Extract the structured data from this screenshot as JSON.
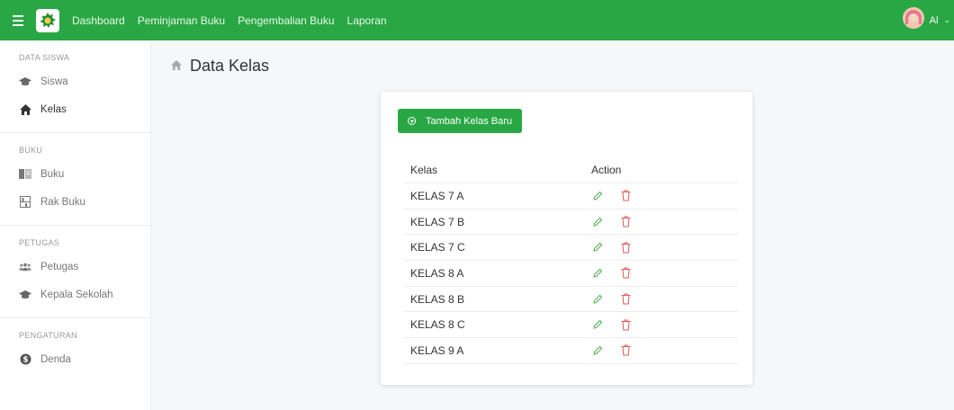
{
  "topbar": {
    "nav": [
      "Dashboard",
      "Peminjaman Buku",
      "Pengembalian Buku",
      "Laporan"
    ],
    "user_name": "Al"
  },
  "sidebar": {
    "sections": [
      {
        "title": "DATA SISWA",
        "items": [
          {
            "label": "Siswa",
            "icon": "graduation-cap-icon"
          },
          {
            "label": "Kelas",
            "icon": "home-icon"
          }
        ]
      },
      {
        "title": "BUKU",
        "items": [
          {
            "label": "Buku",
            "icon": "book-icon"
          },
          {
            "label": "Rak Buku",
            "icon": "shelf-icon"
          }
        ]
      },
      {
        "title": "PETUGAS",
        "items": [
          {
            "label": "Petugas",
            "icon": "users-icon"
          },
          {
            "label": "Kepala Sekolah",
            "icon": "graduation-cap-icon"
          }
        ]
      },
      {
        "title": "PENGATURAN",
        "items": [
          {
            "label": "Denda",
            "icon": "dollar-circle-icon"
          }
        ]
      }
    ],
    "active": "Kelas"
  },
  "page": {
    "title": "Data Kelas"
  },
  "card": {
    "add_button": "Tambah Kelas Baru",
    "columns": [
      "Kelas",
      "Action"
    ],
    "rows": [
      "KELAS 7 A",
      "KELAS 7 B",
      "KELAS 7 C",
      "KELAS 8 A",
      "KELAS 8 B",
      "KELAS 8 C",
      "KELAS 9 A"
    ]
  },
  "colors": {
    "brand": "#29a744",
    "edit": "#4caf50",
    "delete": "#e05a5a"
  }
}
